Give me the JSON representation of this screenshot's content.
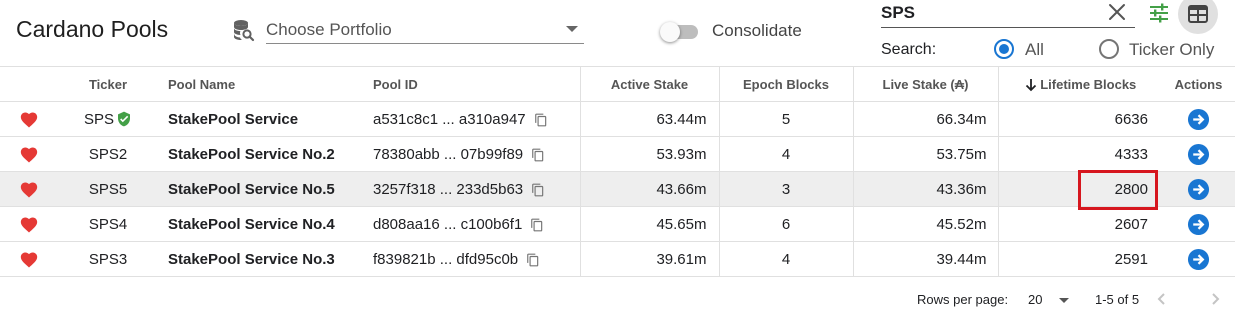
{
  "app": {
    "title": "Cardano Pools"
  },
  "portfolio": {
    "placeholder": "Choose Portfolio"
  },
  "consolidate": {
    "label": "Consolidate",
    "enabled": false
  },
  "search": {
    "value": "SPS",
    "label": "Search:",
    "options": [
      "All",
      "Ticker Only"
    ],
    "selected": "All"
  },
  "table": {
    "columns": {
      "ticker": "Ticker",
      "pool_name": "Pool Name",
      "pool_id": "Pool ID",
      "active_stake": "Active Stake",
      "epoch_blocks": "Epoch Blocks",
      "live_stake": "Live Stake (₳)",
      "lifetime_blocks": "Lifetime Blocks",
      "actions": "Actions"
    },
    "sort": {
      "column": "lifetime_blocks",
      "direction": "desc"
    },
    "rows": [
      {
        "ticker": "SPS",
        "verified": true,
        "name": "StakePool Service",
        "pool_id": "a531c8c1 ... a310a947",
        "active_stake": "63.44m",
        "epoch_blocks": "5",
        "live_stake": "66.34m",
        "lifetime_blocks": "6636"
      },
      {
        "ticker": "SPS2",
        "verified": false,
        "name": "StakePool Service No.2",
        "pool_id": "78380abb ... 07b99f89",
        "active_stake": "53.93m",
        "epoch_blocks": "4",
        "live_stake": "53.75m",
        "lifetime_blocks": "4333"
      },
      {
        "ticker": "SPS5",
        "verified": false,
        "name": "StakePool Service No.5",
        "pool_id": "3257f318 ... 233d5b63",
        "active_stake": "43.66m",
        "epoch_blocks": "3",
        "live_stake": "43.36m",
        "lifetime_blocks": "2800"
      },
      {
        "ticker": "SPS4",
        "verified": false,
        "name": "StakePool Service No.4",
        "pool_id": "d808aa16 ... c100b6f1",
        "active_stake": "45.65m",
        "epoch_blocks": "6",
        "live_stake": "45.52m",
        "lifetime_blocks": "2607"
      },
      {
        "ticker": "SPS3",
        "verified": false,
        "name": "StakePool Service No.3",
        "pool_id": "f839821b ... dfd95c0b",
        "active_stake": "39.61m",
        "epoch_blocks": "4",
        "live_stake": "39.44m",
        "lifetime_blocks": "2591"
      }
    ]
  },
  "footer": {
    "rows_per_page_label": "Rows per page:",
    "rows_per_page": "20",
    "range": "1-5 of 5"
  },
  "colors": {
    "favorite": "#e53935",
    "verified": "#43a047",
    "primary": "#1976d2",
    "filter_icon": "#43a047",
    "highlight_box": "#d6161e"
  },
  "icons": {
    "portfolio": "database-search-icon",
    "clear": "close-icon",
    "filter": "tune-icon",
    "view": "table-view-icon",
    "favorite": "heart-icon",
    "verified": "verified-shield-icon",
    "copy": "copy-icon",
    "action": "arrow-right-circle-icon",
    "sort": "arrow-down-icon"
  }
}
